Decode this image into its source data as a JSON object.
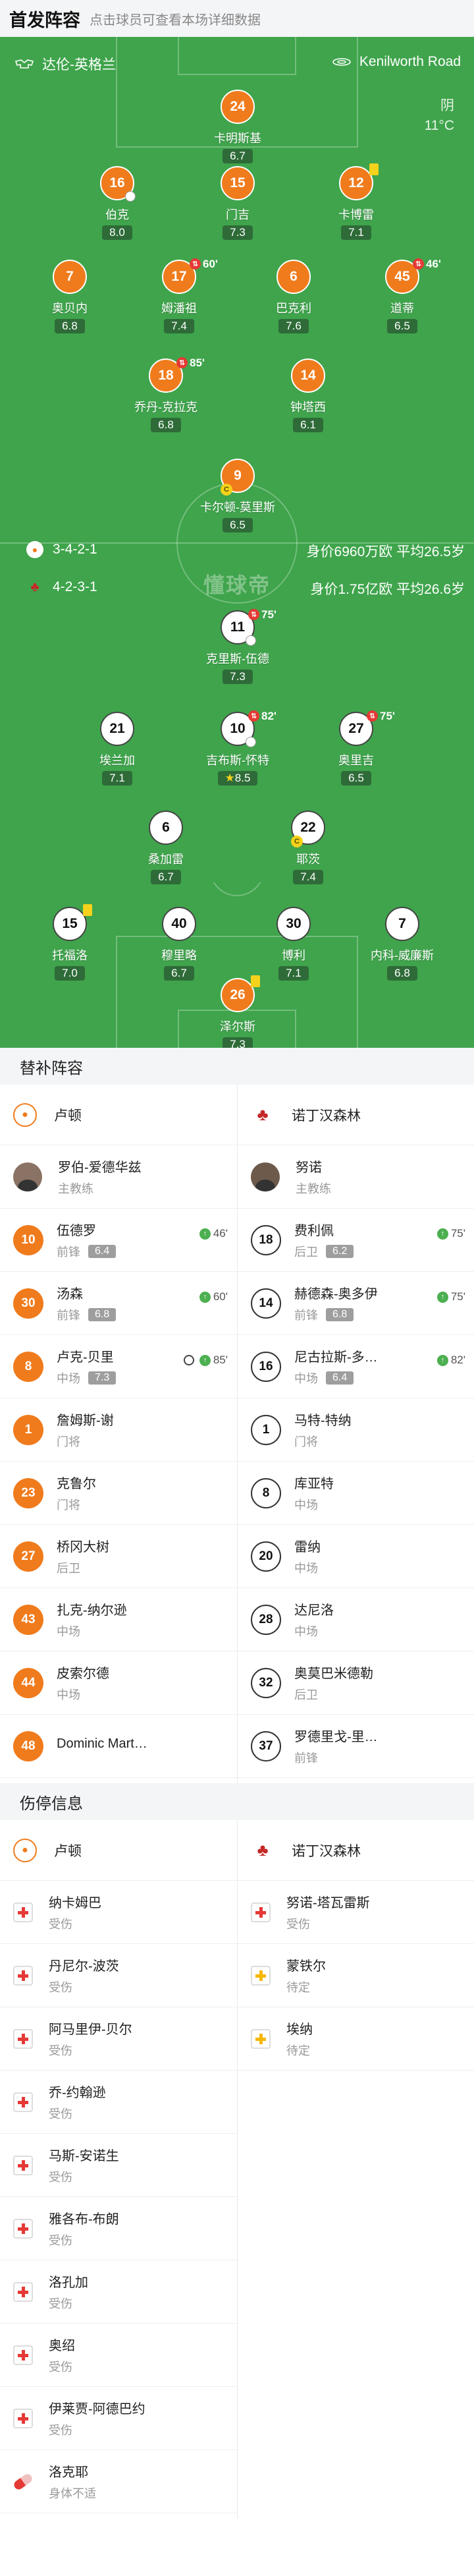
{
  "header": {
    "title": "首发阵容",
    "subtitle": "点击球员可查看本场详细数据"
  },
  "pitch": {
    "home_team": "达伦-英格兰",
    "venue": "Kenilworth Road",
    "weather": "阴",
    "temperature": "11°C",
    "watermark": "懂球帝",
    "home_formation": "3-4-2-1",
    "home_value": "身价6960万欧  平均26.5岁",
    "away_formation": "4-2-3-1",
    "away_value": "身价1.75亿欧  平均26.6岁",
    "home_players": [
      {
        "num": "24",
        "name": "卡明斯基",
        "rating": "6.7"
      },
      {
        "num": "16",
        "name": "伯克",
        "rating": "8.0"
      },
      {
        "num": "15",
        "name": "门吉",
        "rating": "7.3"
      },
      {
        "num": "12",
        "name": "卡博雷",
        "rating": "7.1"
      },
      {
        "num": "7",
        "name": "奥贝内",
        "rating": "6.8"
      },
      {
        "num": "17",
        "name": "姆潘祖",
        "rating": "7.4",
        "sub": "60'"
      },
      {
        "num": "6",
        "name": "巴克利",
        "rating": "7.6"
      },
      {
        "num": "45",
        "name": "道蒂",
        "rating": "6.5",
        "sub": "46'"
      },
      {
        "num": "18",
        "name": "乔丹-克拉克",
        "rating": "6.8",
        "sub": "85'"
      },
      {
        "num": "14",
        "name": "钟塔西",
        "rating": "6.1"
      },
      {
        "num": "9",
        "name": "卡尔顿-莫里斯",
        "rating": "6.5"
      }
    ],
    "away_players": [
      {
        "num": "11",
        "name": "克里斯-伍德",
        "rating": "7.3",
        "sub": "75'"
      },
      {
        "num": "21",
        "name": "埃兰加",
        "rating": "7.1"
      },
      {
        "num": "10",
        "name": "吉布斯-怀特",
        "rating": "8.5",
        "sub": "82'"
      },
      {
        "num": "27",
        "name": "奥里吉",
        "rating": "6.5",
        "sub": "75'"
      },
      {
        "num": "6",
        "name": "桑加雷",
        "rating": "6.7"
      },
      {
        "num": "22",
        "name": "耶茨",
        "rating": "7.4"
      },
      {
        "num": "15",
        "name": "托福洛",
        "rating": "7.0"
      },
      {
        "num": "40",
        "name": "穆里略",
        "rating": "6.7"
      },
      {
        "num": "30",
        "name": "博利",
        "rating": "7.1"
      },
      {
        "num": "7",
        "name": "内科-威廉斯",
        "rating": "6.8"
      },
      {
        "num": "26",
        "name": "泽尔斯",
        "rating": "7.3"
      }
    ]
  },
  "subs": {
    "title": "替补阵容",
    "home": {
      "team": "卢顿",
      "coach_name": "罗伯-爱德华兹",
      "coach_role": "主教练",
      "players": [
        {
          "num": "10",
          "name": "伍德罗",
          "pos": "前锋",
          "rating": "6.4",
          "in": "46'"
        },
        {
          "num": "30",
          "name": "汤森",
          "pos": "前锋",
          "rating": "6.8",
          "in": "60'"
        },
        {
          "num": "8",
          "name": "卢克-贝里",
          "pos": "中场",
          "rating": "7.3",
          "in": "85'"
        },
        {
          "num": "1",
          "name": "詹姆斯-谢",
          "pos": "门将"
        },
        {
          "num": "23",
          "name": "克鲁尔",
          "pos": "门将"
        },
        {
          "num": "27",
          "name": "桥冈大树",
          "pos": "后卫"
        },
        {
          "num": "43",
          "name": "扎克-纳尔逊",
          "pos": "中场"
        },
        {
          "num": "44",
          "name": "皮索尔德",
          "pos": "中场"
        },
        {
          "num": "48",
          "name": "Dominic Mart…",
          "pos": ""
        }
      ]
    },
    "away": {
      "team": "诺丁汉森林",
      "coach_name": "努诺",
      "coach_role": "主教练",
      "players": [
        {
          "num": "18",
          "name": "费利佩",
          "pos": "后卫",
          "rating": "6.2",
          "in": "75'"
        },
        {
          "num": "14",
          "name": "赫德森-奥多伊",
          "pos": "前锋",
          "rating": "6.8",
          "in": "75'"
        },
        {
          "num": "16",
          "name": "尼古拉斯-多…",
          "pos": "中场",
          "rating": "6.4",
          "in": "82'"
        },
        {
          "num": "1",
          "name": "马特-特纳",
          "pos": "门将"
        },
        {
          "num": "8",
          "name": "库亚特",
          "pos": "中场"
        },
        {
          "num": "20",
          "name": "雷纳",
          "pos": "中场"
        },
        {
          "num": "28",
          "name": "达尼洛",
          "pos": "中场"
        },
        {
          "num": "32",
          "name": "奥莫巴米德勒",
          "pos": "后卫"
        },
        {
          "num": "37",
          "name": "罗德里戈-里…",
          "pos": "前锋"
        }
      ]
    }
  },
  "injuries": {
    "title": "伤停信息",
    "home": {
      "team": "卢顿",
      "players": [
        {
          "name": "纳卡姆巴",
          "status": "受伤"
        },
        {
          "name": "丹尼尔-波茨",
          "status": "受伤"
        },
        {
          "name": "阿马里伊-贝尔",
          "status": "受伤"
        },
        {
          "name": "乔-约翰逊",
          "status": "受伤"
        },
        {
          "name": "马斯-安诺生",
          "status": "受伤"
        },
        {
          "name": "雅各布-布朗",
          "status": "受伤"
        },
        {
          "name": "洛孔加",
          "status": "受伤"
        },
        {
          "name": "奥绍",
          "status": "受伤"
        },
        {
          "name": "伊莱贾-阿德巴约",
          "status": "受伤"
        },
        {
          "name": "洛克耶",
          "status": "身体不适"
        }
      ]
    },
    "away": {
      "team": "诺丁汉森林",
      "players": [
        {
          "name": "努诺-塔瓦雷斯",
          "status": "受伤"
        },
        {
          "name": "蒙铁尔",
          "status": "待定"
        },
        {
          "name": "埃纳",
          "status": "待定"
        }
      ]
    }
  },
  "colors": {
    "pitch": "#3fa44c",
    "home": "#f07b1c",
    "away": "#ffffff",
    "rating_bg": "#2e6b38"
  }
}
